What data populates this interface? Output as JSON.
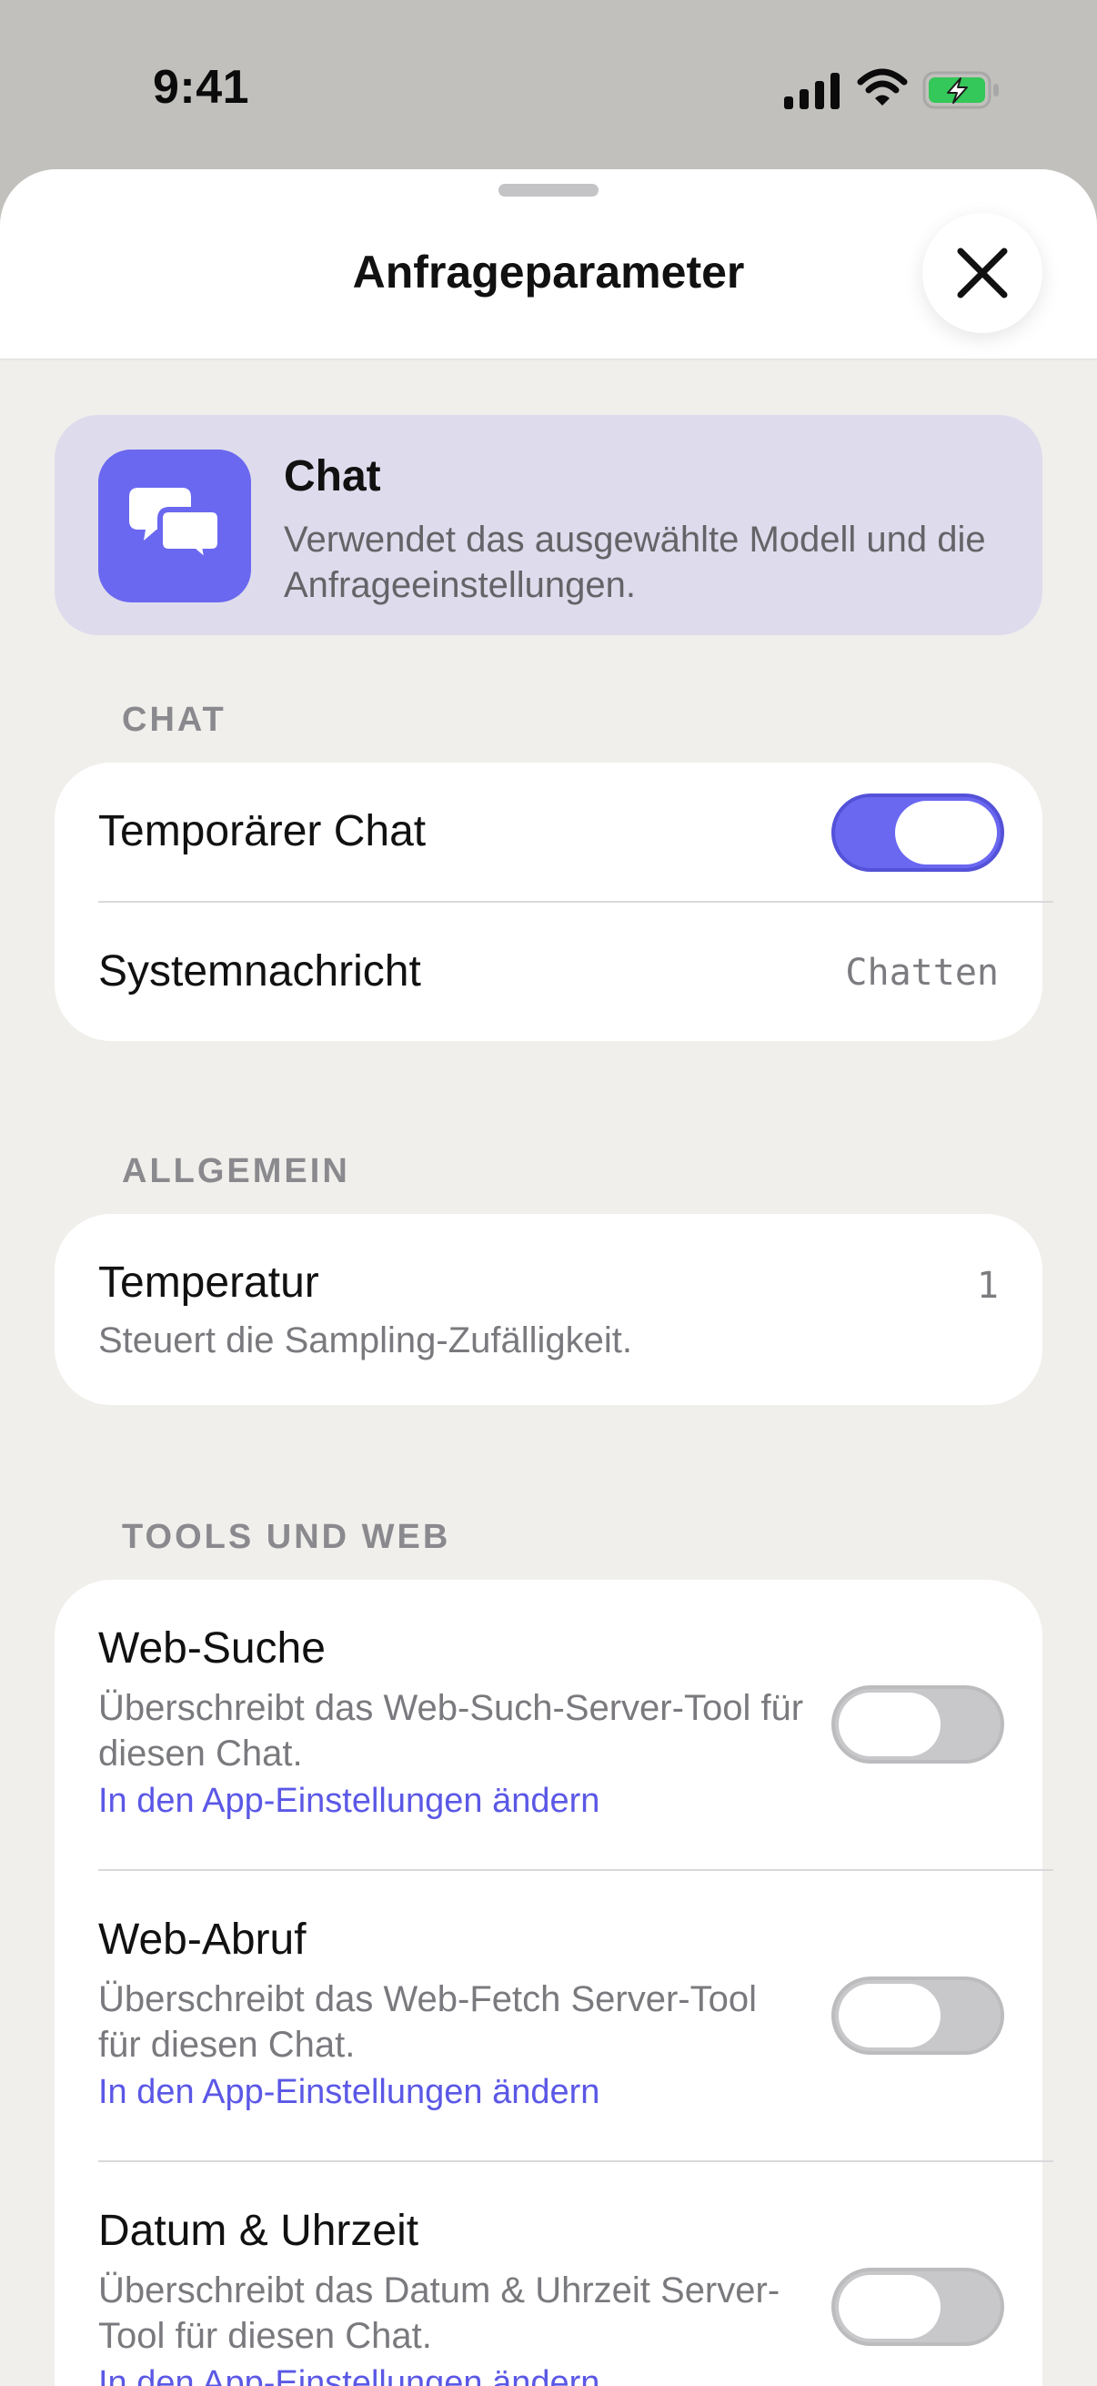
{
  "status_bar": {
    "time": "9:41"
  },
  "sheet": {
    "title": "Anfrageparameter"
  },
  "mode": {
    "title": "Chat",
    "description": "Verwendet das ausgewählte Modell und die Anfrageeinstellungen.",
    "icon": "chat-bubbles-icon",
    "accent_color": "#6a67f0"
  },
  "sections": {
    "chat": {
      "header": "CHAT",
      "temp_chat": {
        "label": "Temporärer Chat",
        "enabled": true
      },
      "system_message": {
        "label": "Systemnachricht",
        "value": "Chatten"
      }
    },
    "general": {
      "header": "ALLGEMEIN",
      "temperature": {
        "label": "Temperatur",
        "description": "Steuert die Sampling-Zufälligkeit.",
        "value": "1"
      }
    },
    "tools": {
      "header": "TOOLS UND WEB",
      "items": [
        {
          "label": "Web-Suche",
          "description": "Überschreibt das Web-Such-Server-Tool für diesen Chat.",
          "link": "In den App-Einstellungen ändern",
          "enabled": false
        },
        {
          "label": "Web-Abruf",
          "description": "Überschreibt das Web-Fetch Server-Tool für diesen Chat.",
          "link": "In den App-Einstellungen ändern",
          "enabled": false
        },
        {
          "label": "Datum & Uhrzeit",
          "description": "Überschreibt das Datum & Uhrzeit Server-Tool für diesen Chat.",
          "link": "In den App-Einstellungen ändern",
          "enabled": false
        }
      ]
    }
  },
  "colors": {
    "accent": "#6a67f0",
    "link": "#5b58e6",
    "battery_charging": "#34c759"
  }
}
